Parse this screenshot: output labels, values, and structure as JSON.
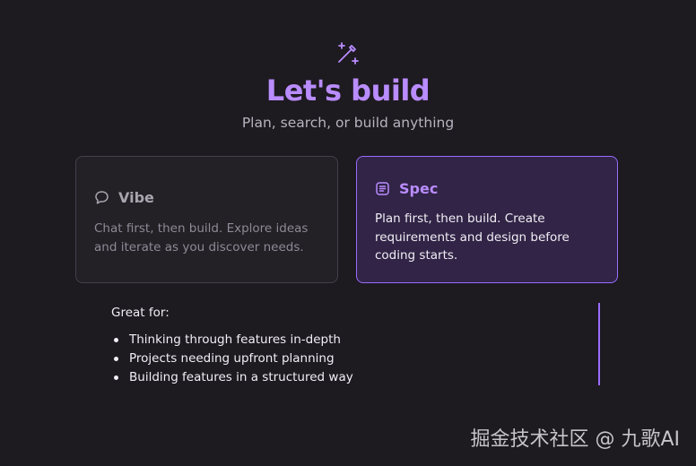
{
  "hero": {
    "icon": "magic-wand-icon",
    "title": "Let's build",
    "subtitle": "Plan, search, or build anything"
  },
  "modes": [
    {
      "id": "vibe",
      "icon": "chat-bubble-icon",
      "title": "Vibe",
      "description": "Chat first, then build. Explore ideas and iterate as you discover needs.",
      "selected": false
    },
    {
      "id": "spec",
      "icon": "document-list-icon",
      "title": "Spec",
      "description": "Plan first, then build. Create requirements and design before coding starts.",
      "selected": true
    }
  ],
  "details": {
    "heading": "Great for:",
    "items": [
      "Thinking through features in-depth",
      "Projects needing upfront planning",
      "Building features in a structured way"
    ]
  },
  "watermark": "掘金技术社区 @ 九歌AI",
  "colors": {
    "accent": "#b98cff",
    "selected_border": "#9a6cff",
    "selected_bg": "#312446",
    "background": "#1d1a20"
  }
}
